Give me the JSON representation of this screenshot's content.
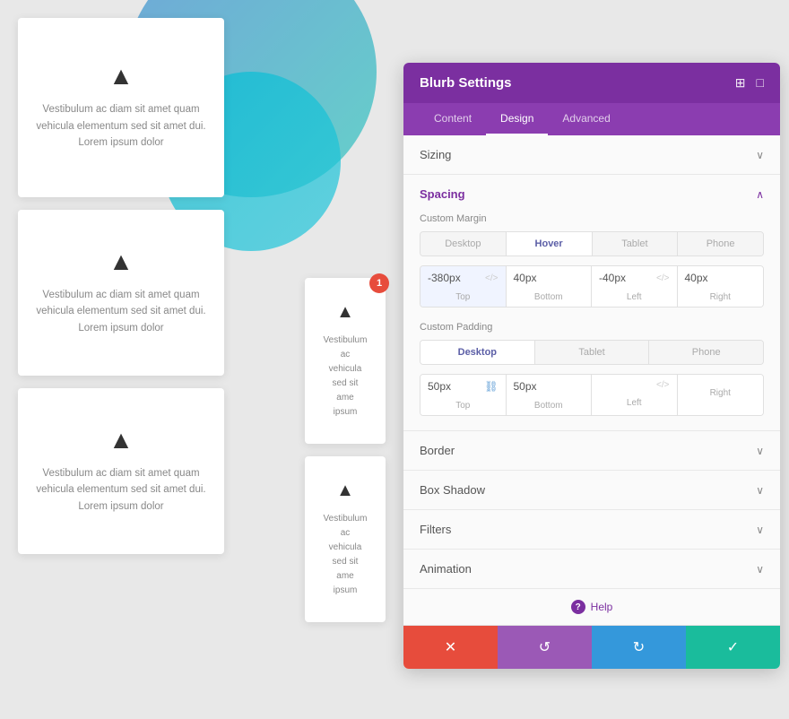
{
  "canvas": {
    "background_color": "#e8e8e8"
  },
  "cards": [
    {
      "id": "card-1",
      "size": "large",
      "icon": "▲",
      "text": "Vestibulum ac diam sit amet\nquam vehicula elementum\nsed sit amet dui. Lorem\nipsum dolor"
    },
    {
      "id": "card-2",
      "size": "medium",
      "icon": "▲",
      "text": "Vestibulum ac diam sit amet\nquam vehicula elementum\nsed sit amet dui. Lorem\nipsum dolor"
    },
    {
      "id": "card-3",
      "size": "medium",
      "icon": "▲",
      "text": "Vestibulum ac diam sit amet\nquam vehicula elementum\nsed sit amet dui. Lorem\nipsum dolor"
    }
  ],
  "partial_cards": [
    {
      "id": "partial-1",
      "icon": "▲",
      "text": "Vestibulum ac\nvehicula\nsed sit ame\nipsum"
    },
    {
      "id": "partial-2",
      "icon": "▲",
      "text": "Vestibulum ac\nvehicula\nsed sit ame\nipsum"
    }
  ],
  "panel": {
    "title": "Blurb Settings",
    "header_icons": [
      "⊞",
      "□"
    ],
    "tabs": [
      {
        "label": "Content",
        "active": false
      },
      {
        "label": "Design",
        "active": true
      },
      {
        "label": "Advanced",
        "active": false
      }
    ],
    "sections": [
      {
        "id": "sizing",
        "label": "Sizing",
        "expanded": false,
        "color": "normal"
      },
      {
        "id": "spacing",
        "label": "Spacing",
        "expanded": true,
        "color": "purple",
        "subsections": [
          {
            "id": "custom-margin",
            "label": "Custom Margin",
            "device_tabs": [
              "Desktop",
              "Hover",
              "Tablet",
              "Phone"
            ],
            "active_device": "Hover",
            "inputs": [
              {
                "id": "top",
                "value": "-380px",
                "label": "Top",
                "has_code_icon": true,
                "highlighted": true
              },
              {
                "id": "bottom",
                "value": "40px",
                "label": "Bottom",
                "has_code_icon": false
              },
              {
                "id": "left",
                "value": "-40px",
                "label": "Left",
                "has_code_icon": true
              },
              {
                "id": "right",
                "value": "40px",
                "label": "Right",
                "has_code_icon": false
              }
            ]
          },
          {
            "id": "custom-padding",
            "label": "Custom Padding",
            "device_tabs": [
              "Desktop",
              "Tablet",
              "Phone"
            ],
            "active_device": "Desktop",
            "inputs": [
              {
                "id": "top",
                "value": "50px",
                "label": "Top",
                "has_link_icon": true
              },
              {
                "id": "bottom",
                "value": "50px",
                "label": "Bottom",
                "has_link_icon": false
              },
              {
                "id": "left",
                "value": "",
                "label": "Left",
                "has_code_icon": true
              },
              {
                "id": "right",
                "value": "",
                "label": "Right",
                "has_code_icon": false
              }
            ]
          }
        ]
      },
      {
        "id": "border",
        "label": "Border",
        "expanded": false,
        "color": "normal"
      },
      {
        "id": "box-shadow",
        "label": "Box Shadow",
        "expanded": false,
        "color": "normal"
      },
      {
        "id": "filters",
        "label": "Filters",
        "expanded": false,
        "color": "normal"
      },
      {
        "id": "animation",
        "label": "Animation",
        "expanded": false,
        "color": "normal"
      }
    ],
    "help_label": "Help",
    "badge_number": "1",
    "footer_buttons": [
      {
        "id": "cancel",
        "icon": "✕",
        "color": "#e74c3c"
      },
      {
        "id": "undo",
        "icon": "↺",
        "color": "#9b59b6"
      },
      {
        "id": "redo",
        "icon": "↻",
        "color": "#3498db"
      },
      {
        "id": "save",
        "icon": "✓",
        "color": "#1abc9c"
      }
    ]
  }
}
